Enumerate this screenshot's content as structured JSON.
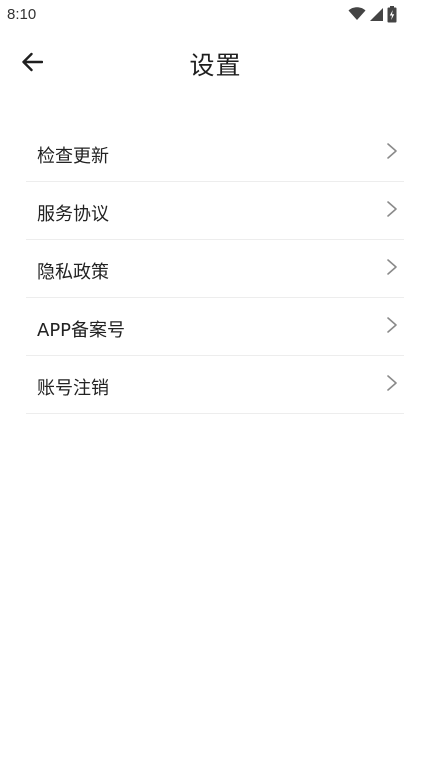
{
  "status_bar": {
    "time": "8:10",
    "icons": [
      "wifi-icon",
      "cellular-signal-icon",
      "battery-charging-icon"
    ]
  },
  "header": {
    "title": "设置",
    "back_icon": "arrow-left-icon"
  },
  "menu": {
    "items": [
      {
        "label": "检查更新"
      },
      {
        "label": "服务协议"
      },
      {
        "label": "隐私政策"
      },
      {
        "label": "APP备案号"
      },
      {
        "label": "账号注销"
      }
    ],
    "chevron_icon": "chevron-right-icon"
  },
  "colors": {
    "background": "#ffffff",
    "text": "#222222",
    "divider": "#ededed",
    "chevron": "#8a8a8a"
  }
}
